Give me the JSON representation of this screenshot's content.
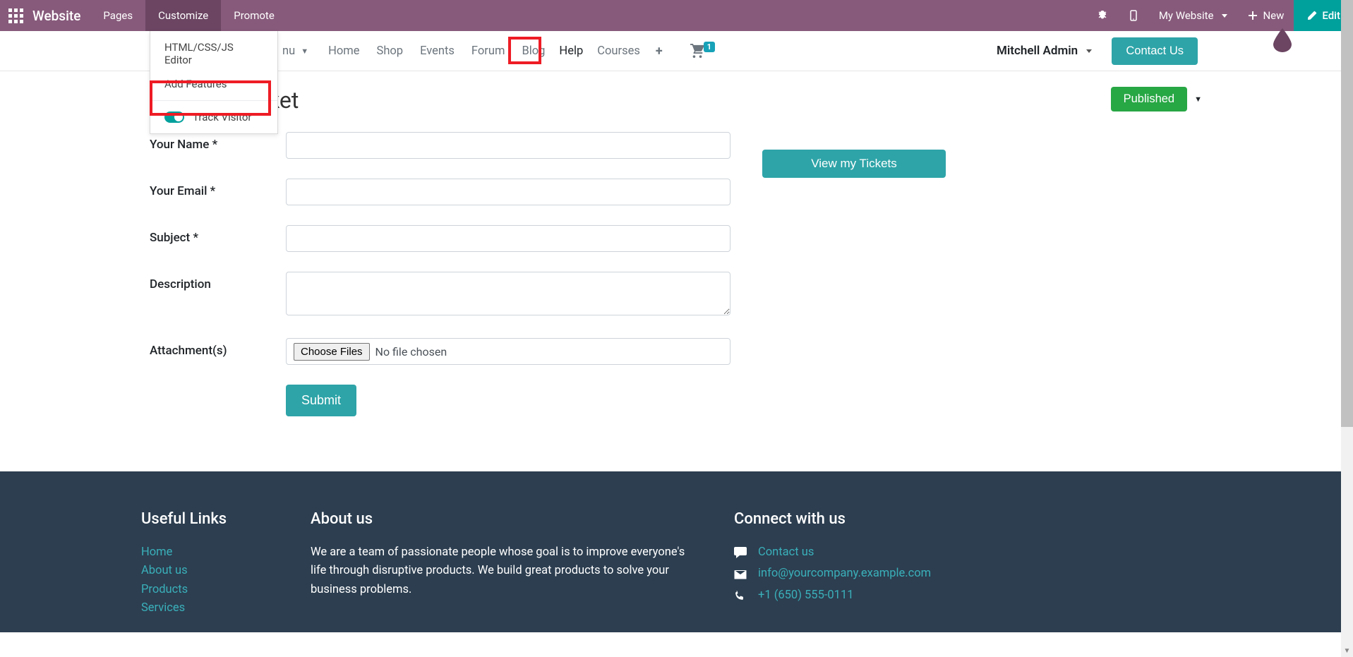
{
  "topbar": {
    "brand": "Website",
    "menu": [
      "Pages",
      "Customize",
      "Promote"
    ],
    "my_website": "My Website",
    "new_label": "New",
    "edit_label": "Edit"
  },
  "dropdown": {
    "item1": "HTML/CSS/JS Editor",
    "item2": "Add Features",
    "toggle_label": "Track Visitor"
  },
  "nav": {
    "fragment": "nu",
    "items": [
      "Home",
      "Shop",
      "Events",
      "Forum",
      "Blog",
      "Help",
      "Courses"
    ],
    "cart_count": "1",
    "user": "Mitchell Admin",
    "contact": "Contact Us"
  },
  "page": {
    "title_fragment": "ket",
    "published": "Published",
    "view_tickets": "View my Tickets"
  },
  "form": {
    "name_label": "Your Name",
    "email_label": "Your Email",
    "subject_label": "Subject",
    "description_label": "Description",
    "attachments_label": "Attachment(s)",
    "choose_files": "Choose Files",
    "no_file": "No file chosen",
    "submit": "Submit",
    "required": "*"
  },
  "footer": {
    "useful_heading": "Useful Links",
    "links": [
      "Home",
      "About us",
      "Products",
      "Services"
    ],
    "about_heading": "About us",
    "about_text": "We are a team of passionate people whose goal is to improve everyone's life through disruptive products. We build great products to solve your business problems.",
    "connect_heading": "Connect with us",
    "contact_us": "Contact us",
    "email": "info@yourcompany.example.com",
    "phone": "+1 (650) 555-0111"
  }
}
